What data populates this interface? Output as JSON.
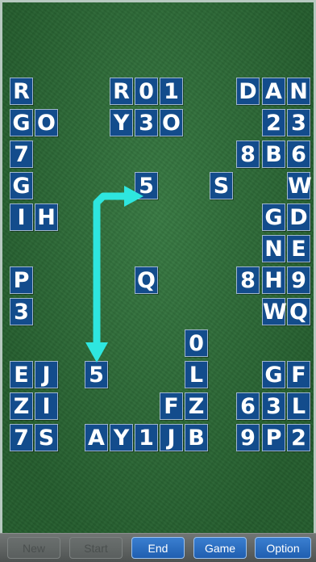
{
  "tiles": [
    {
      "id": "r1c1",
      "label": "R"
    },
    {
      "id": "r1c5",
      "label": "R"
    },
    {
      "id": "r1c6",
      "label": "0"
    },
    {
      "id": "r1c7",
      "label": "1"
    },
    {
      "id": "r1c10",
      "label": "D"
    },
    {
      "id": "r1c11",
      "label": "A"
    },
    {
      "id": "r1c12",
      "label": "N"
    },
    {
      "id": "r2c1",
      "label": "G"
    },
    {
      "id": "r2c2",
      "label": "O"
    },
    {
      "id": "r2c5",
      "label": "Y"
    },
    {
      "id": "r2c6",
      "label": "3"
    },
    {
      "id": "r2c7",
      "label": "O"
    },
    {
      "id": "r2c11",
      "label": "2"
    },
    {
      "id": "r2c12",
      "label": "3"
    },
    {
      "id": "r3c1",
      "label": "7"
    },
    {
      "id": "r3c10",
      "label": "8"
    },
    {
      "id": "r3c11",
      "label": "B"
    },
    {
      "id": "r3c12",
      "label": "6"
    },
    {
      "id": "r4c1",
      "label": "G"
    },
    {
      "id": "r4c6",
      "label": "5"
    },
    {
      "id": "r4c9",
      "label": "S"
    },
    {
      "id": "r4c12",
      "label": "W"
    },
    {
      "id": "r5c1",
      "label": "I"
    },
    {
      "id": "r5c2",
      "label": "H"
    },
    {
      "id": "r5c11",
      "label": "G"
    },
    {
      "id": "r5c12",
      "label": "D"
    },
    {
      "id": "r6c11",
      "label": "N"
    },
    {
      "id": "r6c12",
      "label": "E"
    },
    {
      "id": "r7c1",
      "label": "P"
    },
    {
      "id": "r7c6",
      "label": "Q"
    },
    {
      "id": "r7c10",
      "label": "8"
    },
    {
      "id": "r7c11",
      "label": "H"
    },
    {
      "id": "r7c12",
      "label": "9"
    },
    {
      "id": "r8c1",
      "label": "3"
    },
    {
      "id": "r8c11",
      "label": "W"
    },
    {
      "id": "r8c12",
      "label": "Q"
    },
    {
      "id": "r9c8",
      "label": "0"
    },
    {
      "id": "r10c1",
      "label": "E"
    },
    {
      "id": "r10c2",
      "label": "J"
    },
    {
      "id": "r10c4",
      "label": "5"
    },
    {
      "id": "r10c8",
      "label": "L"
    },
    {
      "id": "r10c11",
      "label": "G"
    },
    {
      "id": "r10c12",
      "label": "F"
    },
    {
      "id": "r11c1",
      "label": "Z"
    },
    {
      "id": "r11c2",
      "label": "I"
    },
    {
      "id": "r11c7",
      "label": "F"
    },
    {
      "id": "r11c8",
      "label": "Z"
    },
    {
      "id": "r11c10",
      "label": "6"
    },
    {
      "id": "r11c11",
      "label": "3"
    },
    {
      "id": "r11c12",
      "label": "L"
    },
    {
      "id": "r12c1",
      "label": "7"
    },
    {
      "id": "r12c2",
      "label": "S"
    },
    {
      "id": "r12c4",
      "label": "A"
    },
    {
      "id": "r12c5",
      "label": "Y"
    },
    {
      "id": "r12c6",
      "label": "1"
    },
    {
      "id": "r12c7",
      "label": "J"
    },
    {
      "id": "r12c8",
      "label": "B"
    },
    {
      "id": "r12c10",
      "label": "9"
    },
    {
      "id": "r12c11",
      "label": "P"
    },
    {
      "id": "r12c12",
      "label": "2"
    }
  ],
  "toolbar": {
    "new_label": "New",
    "start_label": "Start",
    "end_label": "End",
    "game_label": "Game",
    "option_label": "Option"
  },
  "colors": {
    "felt": "#2d7238",
    "tile": "#134c8c",
    "path": "#2ee6df",
    "button": "#2a6fc4"
  },
  "hint_path": {
    "from": "r4c6",
    "to": "r10c4",
    "icon": "connection-path-arrow"
  }
}
